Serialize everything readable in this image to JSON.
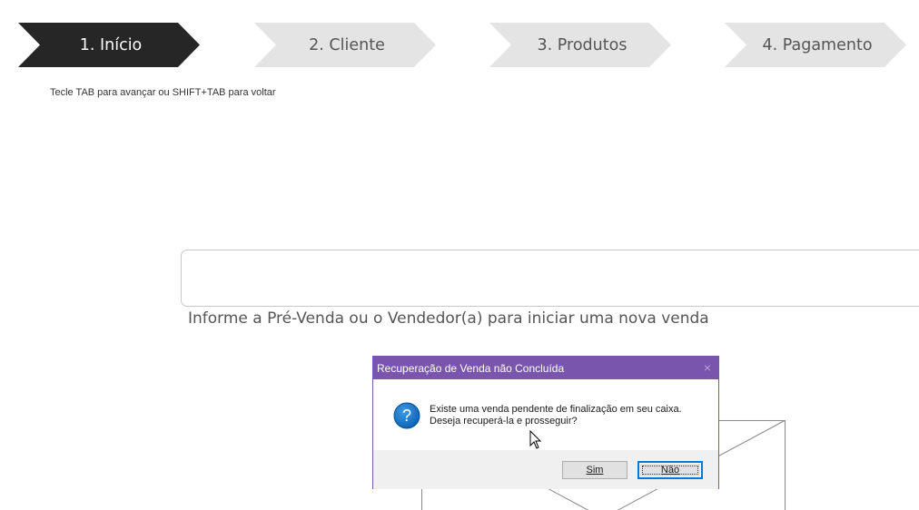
{
  "wizard": {
    "steps": [
      {
        "label": "1. Início",
        "active": true
      },
      {
        "label": "2. Cliente",
        "active": false
      },
      {
        "label": "3. Produtos",
        "active": false
      },
      {
        "label": "4. Pagamento",
        "active": false
      }
    ],
    "hint": "Tecle TAB para avançar ou SHIFT+TAB para voltar"
  },
  "main": {
    "input_value": "",
    "input_label": "Informe a Pré-Venda ou o Vendedor(a) para iniciar uma nova venda"
  },
  "dialog": {
    "title": "Recuperação de Venda não Concluída",
    "close_icon": "×",
    "icon": "question-icon",
    "message_line1": "Existe uma venda pendente de finalização em seu caixa.",
    "message_line2": "Deseja recuperá-la e prosseguir?",
    "yes_label": "Sim",
    "no_label": "Não"
  },
  "colors": {
    "active_step": "#262626",
    "inactive_step": "#e4e4e4",
    "dialog_title": "#7a55ad",
    "focus_border": "#0078d7"
  }
}
